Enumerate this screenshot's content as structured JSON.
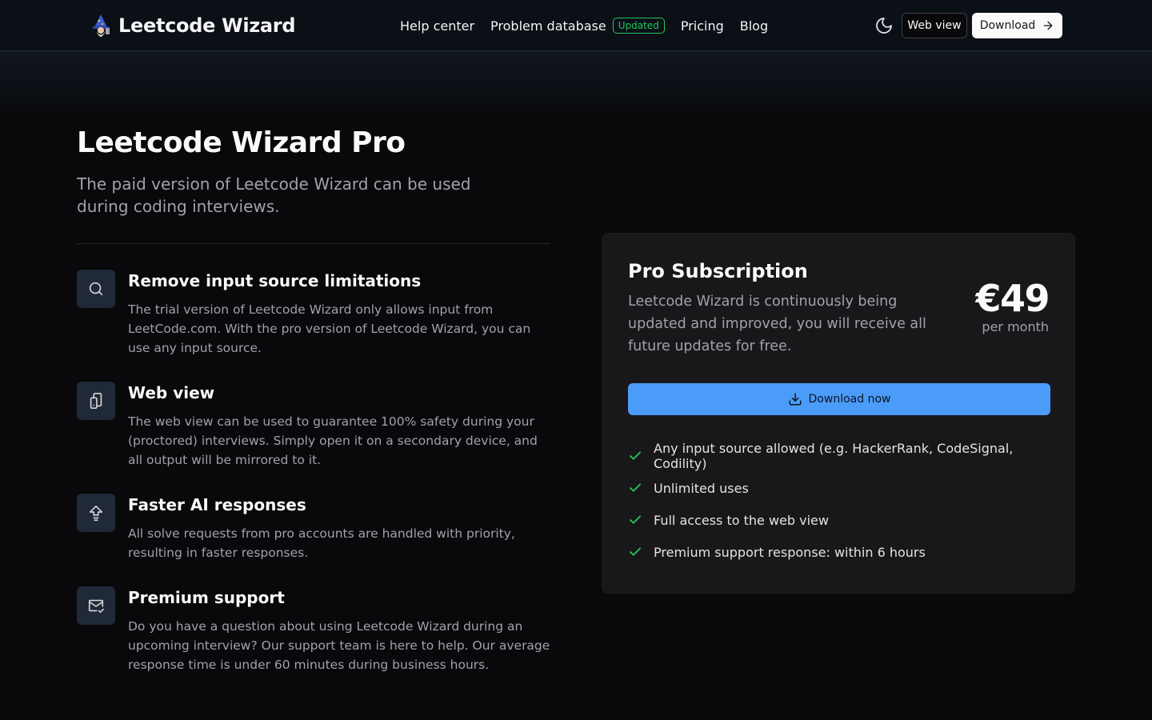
{
  "header": {
    "brand": "Leetcode Wizard",
    "nav": [
      {
        "label": "Help center"
      },
      {
        "label": "Problem database",
        "badge": "Updated"
      },
      {
        "label": "Pricing"
      },
      {
        "label": "Blog"
      }
    ],
    "web_view_label": "Web view",
    "download_label": "Download"
  },
  "hero": {
    "title": "Leetcode Wizard Pro",
    "subtitle": "The paid version of Leetcode Wizard can be used during coding interviews."
  },
  "features": [
    {
      "icon": "search-icon",
      "title": "Remove input source limitations",
      "desc": "The trial version of Leetcode Wizard only allows input from LeetCode.com. With the pro version of Leetcode Wizard, you can use any input source."
    },
    {
      "icon": "devices-icon",
      "title": "Web view",
      "desc": "The web view can be used to guarantee 100% safety during your (proctored) interviews. Simply open it on a secondary device, and all output will be mirrored to it."
    },
    {
      "icon": "arrow-up-icon",
      "title": "Faster AI responses",
      "desc": "All solve requests from pro accounts are handled with priority, resulting in faster responses."
    },
    {
      "icon": "mail-check-icon",
      "title": "Premium support",
      "desc": "Do you have a question about using Leetcode Wizard during an upcoming interview? Our support team is here to help. Our average response time is under 60 minutes during business hours."
    }
  ],
  "card": {
    "title": "Pro Subscription",
    "desc": "Leetcode Wizard is continuously being updated and improved, you will receive all future updates for free.",
    "price": "€49",
    "period": "per month",
    "cta_label": "Download now",
    "items": [
      "Any input source allowed (e.g. HackerRank, CodeSignal, Codility)",
      "Unlimited uses",
      "Full access to the web view",
      "Premium support response: within 6 hours"
    ]
  },
  "colors": {
    "accent": "#4b9cf9",
    "success": "#22c55e",
    "background": "#09090b",
    "card": "#18181b"
  }
}
